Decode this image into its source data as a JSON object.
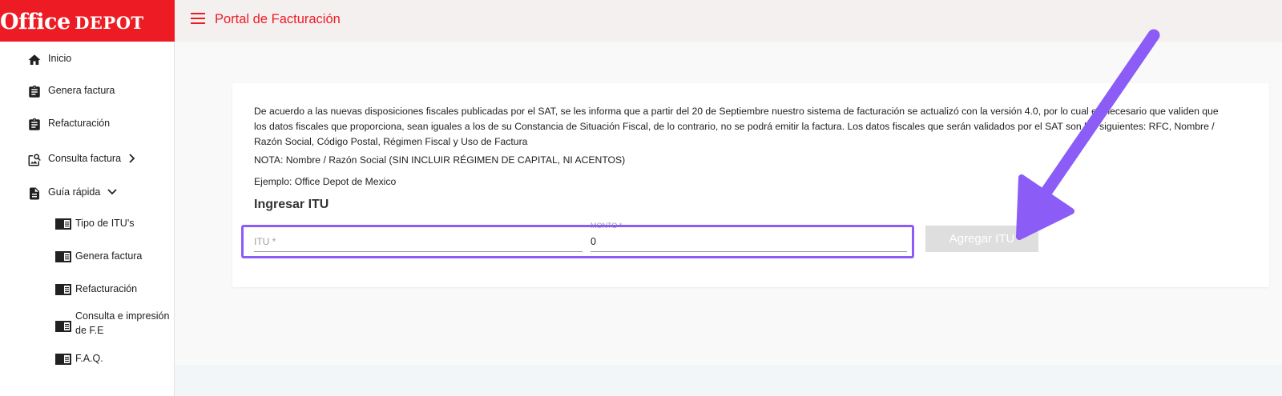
{
  "logo": {
    "word1": "Office",
    "word2": "DEPOT"
  },
  "header": {
    "title": "Portal de Facturación"
  },
  "sidebar": {
    "items": [
      {
        "label": "Inicio",
        "icon": "home-icon"
      },
      {
        "label": "Genera factura",
        "icon": "clipboard-icon"
      },
      {
        "label": "Refacturación",
        "icon": "clipboard-icon"
      },
      {
        "label": "Consulta factura",
        "icon": "image-search-icon"
      },
      {
        "label": "Guía rápida",
        "icon": "document-icon"
      }
    ],
    "subitems": [
      {
        "label": "Tipo de ITU's",
        "icon": "chrome-reader-icon"
      },
      {
        "label": "Genera factura",
        "icon": "chrome-reader-icon"
      },
      {
        "label": "Refacturación",
        "icon": "chrome-reader-icon"
      },
      {
        "label": "Consulta e impresión de F.E",
        "icon": "chrome-reader-icon"
      },
      {
        "label": "F.A.Q.",
        "icon": "chrome-reader-icon"
      }
    ]
  },
  "main": {
    "notice": "De acuerdo a las nuevas disposiciones fiscales publicadas por el SAT, se les informa que a partir del 20 de Septiembre nuestro sistema de facturación se actualizó con la versión 4.0, por lo cual es necesario que validen que los datos fiscales que proporciona, sean iguales a los de su Constancia de Situación Fiscal, de lo contrario, no se podrá emitir la factura. Los datos fiscales que serán validados por el SAT son los siguientes: RFC, Nombre / Razón Social, Código Postal, Régimen Fiscal y Uso de Factura",
    "nota": "NOTA: Nombre / Razón Social (SIN INCLUIR RÉGIMEN DE CAPITAL, NI ACENTOS)",
    "ejemplo": "Ejemplo: Office Depot de Mexico",
    "section_title": "Ingresar ITU",
    "itu_label": "ITU *",
    "monto_label": "MONTO *",
    "monto_value": "0",
    "button_label": "Agregar ITU"
  },
  "colors": {
    "brand": "#ed1c24",
    "highlight": "#8b5cf6"
  }
}
